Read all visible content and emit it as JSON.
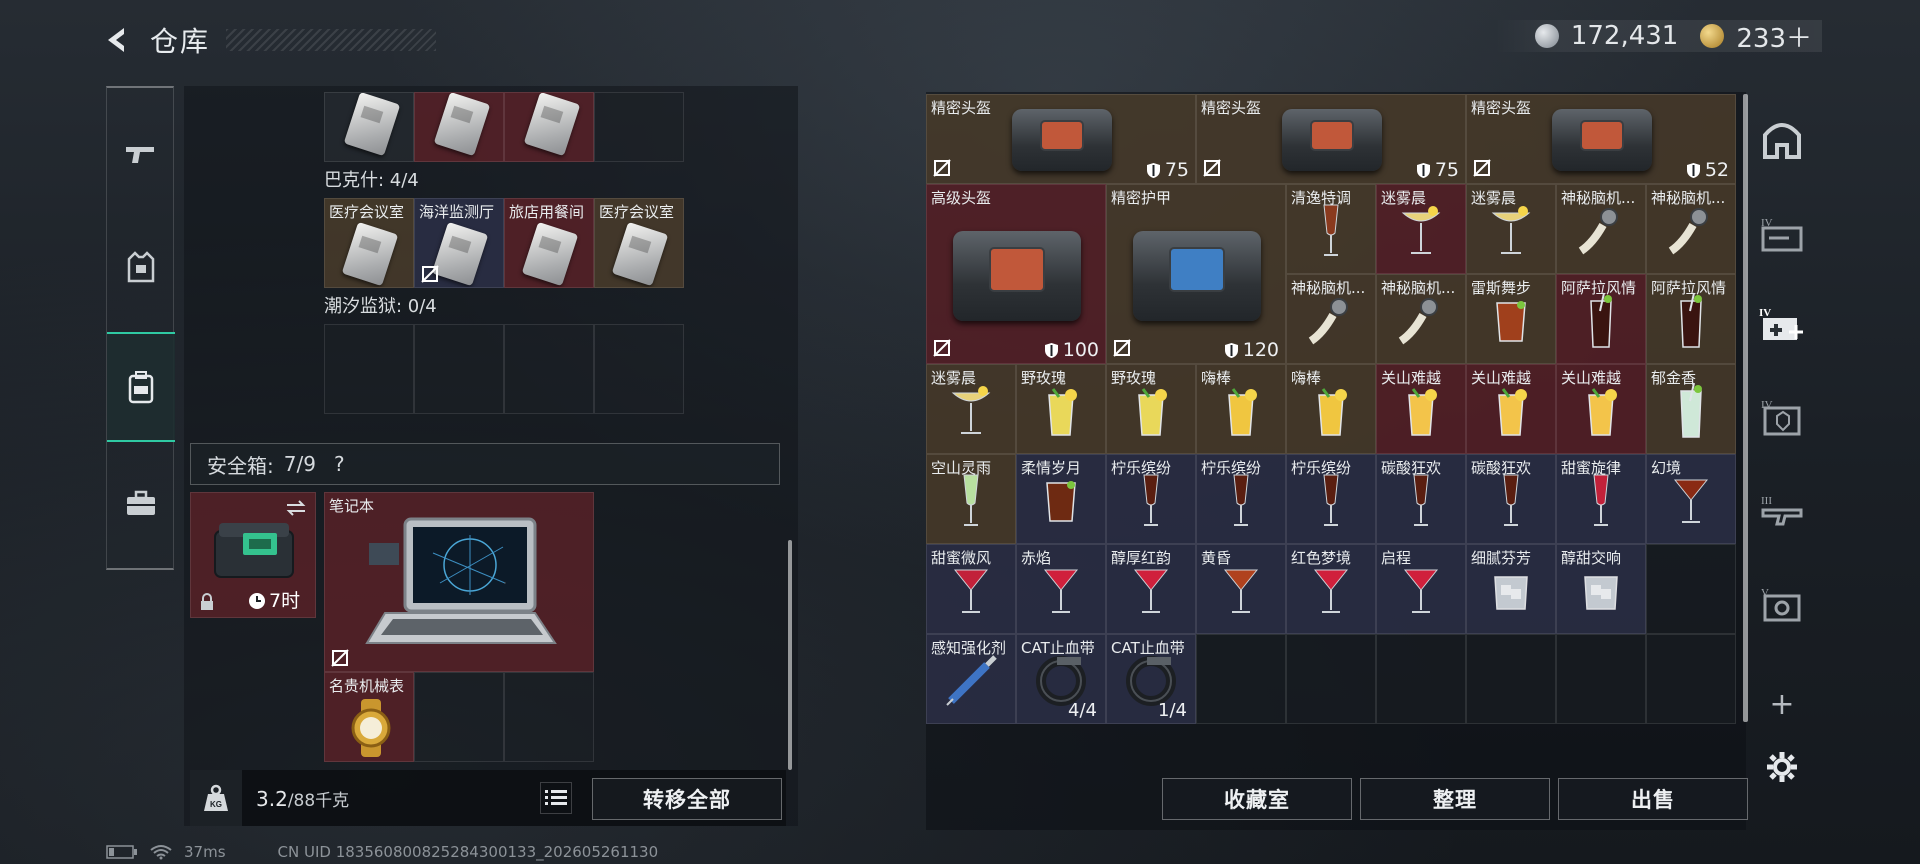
{
  "header": {
    "title": "仓库",
    "currency_silver": "172,431",
    "currency_gold": "233＋"
  },
  "left": {
    "baxiong_label": "巴克什: 4/4",
    "keycards_row2": [
      "医疗会议室",
      "海洋监测厅",
      "旅店用餐间",
      "医疗会议室"
    ],
    "chaoxi_label": "潮汐监狱: 0/4",
    "safe_label": "安全箱:",
    "safe_count": "7/9",
    "safe_help": "?",
    "safe_timer": "7时",
    "laptop_label": "笔记本",
    "watch_label": "名贵机械表",
    "weight_current": "3.2",
    "weight_capacity": "/88千克",
    "transfer_all": "转移全部",
    "kg_icon_text": "KG"
  },
  "right": {
    "items": [
      {
        "label": "精密头盔",
        "stat": "75"
      },
      {
        "label": "精密头盔",
        "stat": "75"
      },
      {
        "label": "精密头盔",
        "stat": "52"
      },
      {
        "label": "高级头盔",
        "stat": "100"
      },
      {
        "label": "精密护甲",
        "stat": "120"
      },
      {
        "label": "清逸特调"
      },
      {
        "label": "迷雾晨"
      },
      {
        "label": "迷雾晨"
      },
      {
        "label": "神秘脑机..."
      },
      {
        "label": "神秘脑机..."
      },
      {
        "label": "神秘脑机..."
      },
      {
        "label": "神秘脑机..."
      },
      {
        "label": "雷斯舞步"
      },
      {
        "label": "阿萨拉风情"
      },
      {
        "label": "阿萨拉风情"
      },
      {
        "label": "迷雾晨"
      },
      {
        "label": "野玫瑰"
      },
      {
        "label": "野玫瑰"
      },
      {
        "label": "嗨棒"
      },
      {
        "label": "嗨棒"
      },
      {
        "label": "关山难越"
      },
      {
        "label": "关山难越"
      },
      {
        "label": "关山难越"
      },
      {
        "label": "郁金香"
      },
      {
        "label": "空山灵雨"
      },
      {
        "label": "柔情岁月"
      },
      {
        "label": "柠乐缤纷"
      },
      {
        "label": "柠乐缤纷"
      },
      {
        "label": "柠乐缤纷"
      },
      {
        "label": "碳酸狂欢"
      },
      {
        "label": "碳酸狂欢"
      },
      {
        "label": "甜蜜旋律"
      },
      {
        "label": "幻境"
      },
      {
        "label": "甜蜜微风"
      },
      {
        "label": "赤焰"
      },
      {
        "label": "醇厚红韵"
      },
      {
        "label": "黄昏"
      },
      {
        "label": "红色梦境"
      },
      {
        "label": "启程"
      },
      {
        "label": "细腻芬芳"
      },
      {
        "label": "醇甜交响"
      },
      {
        "label": "感知强化剂"
      },
      {
        "label": "CAT止血带",
        "stack": "4/4"
      },
      {
        "label": "CAT止血带",
        "stack": "1/4"
      }
    ],
    "collection_btn": "收藏室",
    "sort_btn": "整理",
    "sell_btn": "出售",
    "sidebar_labels": [
      "IV",
      "IV",
      "IV",
      "III",
      "V"
    ]
  },
  "status": {
    "ping": "37ms",
    "uid": "CN UID 183560800825284300133_202605261130"
  },
  "colors": {
    "accent": "#2fcaa3",
    "red_cell": "#60222a",
    "navy_cell": "#2c2f46",
    "brown_cell": "#50402c"
  }
}
